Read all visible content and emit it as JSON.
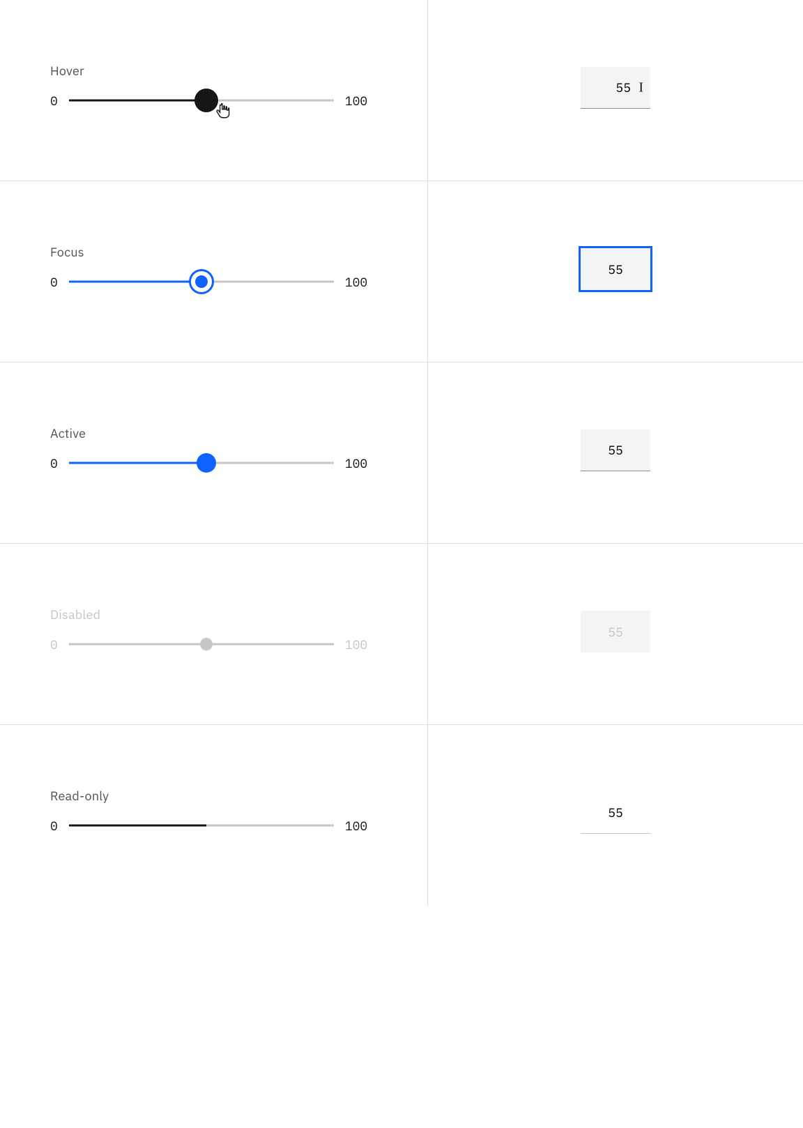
{
  "slider_min": "0",
  "slider_max": "100",
  "hover": {
    "label": "Hover",
    "value": "55",
    "percent": 55
  },
  "focus": {
    "label": "Focus",
    "value": "55",
    "percent": 55
  },
  "active": {
    "label": "Active",
    "value": "55",
    "percent": 55
  },
  "disabled": {
    "label": "Disabled",
    "value": "55",
    "percent": 55
  },
  "readonly": {
    "label": "Read-only",
    "value": "55",
    "percent": 55
  }
}
